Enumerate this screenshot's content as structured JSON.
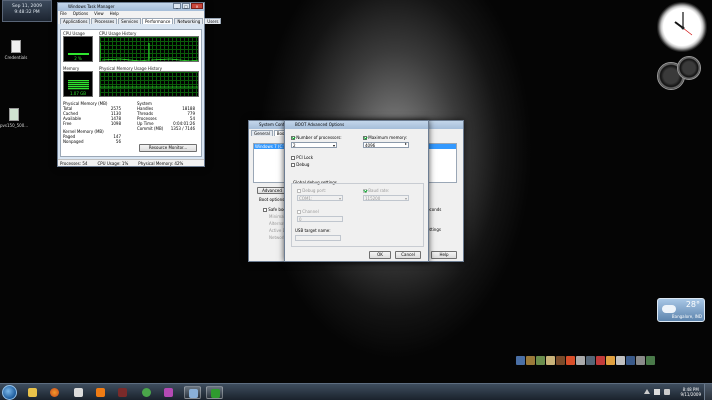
{
  "desktop": {
    "clock_gadget": {
      "date": "Sep 11, 2009",
      "time": "9:48:32 PM"
    },
    "icons": [
      {
        "label": "Credentials"
      },
      {
        "label": "pvs150_500..."
      }
    ],
    "weather": {
      "temp": "28°",
      "location": "Bangalore, IND"
    }
  },
  "task_manager": {
    "title": "Windows Task Manager",
    "menu": [
      "File",
      "Options",
      "View",
      "Help"
    ],
    "tabs": [
      "Applications",
      "Processes",
      "Services",
      "Performance",
      "Networking",
      "Users"
    ],
    "active_tab": "Performance",
    "cpu_usage_label": "CPU Usage",
    "cpu_usage_value": "2 %",
    "cpu_history_label": "CPU Usage History",
    "memory_label": "Memory",
    "memory_value": "1.07 GB",
    "memory_history_label": "Physical Memory Usage History",
    "physical_memory": {
      "header": "Physical Memory (MB)",
      "rows": [
        {
          "k": "Total",
          "v": "2575"
        },
        {
          "k": "Cached",
          "v": "1130"
        },
        {
          "k": "Available",
          "v": "1478"
        },
        {
          "k": "Free",
          "v": "1098"
        }
      ]
    },
    "kernel_memory": {
      "header": "Kernel Memory (MB)",
      "rows": [
        {
          "k": "Paged",
          "v": "147"
        },
        {
          "k": "Nonpaged",
          "v": "56"
        }
      ]
    },
    "system": {
      "header": "System",
      "rows": [
        {
          "k": "Handles",
          "v": "18188"
        },
        {
          "k": "Threads",
          "v": "779"
        },
        {
          "k": "Processes",
          "v": "54"
        },
        {
          "k": "Up Time",
          "v": "0:04:01:26"
        },
        {
          "k": "Commit (MB)",
          "v": "1353 / 7146"
        }
      ]
    },
    "resource_monitor_button": "Resource Monitor...",
    "status": {
      "processes": "Processes: 54",
      "cpu": "CPU Usage: 1%",
      "memory": "Physical Memory: 42%"
    }
  },
  "system_config": {
    "title": "System Configuration",
    "tabs": [
      "General",
      "Boot"
    ],
    "boot_entry": "Windows 7 (C:\\Windows) : Current OS; Default OS",
    "advanced_button": "Advanced options...",
    "boot_options_label": "Boot options",
    "safe_boot_label": "Safe boot",
    "minimal_label": "Minimal",
    "alternate_shell_label": "Alternate shell",
    "active_directory_label": "Active Directory repair",
    "network_label": "Network",
    "seconds_label": "seconds",
    "settings_label": "settings",
    "help_button": "Help"
  },
  "boot_advanced": {
    "title": "BOOT Advanced Options",
    "num_processors_label": "Number of processors:",
    "num_processors_value": "2",
    "max_memory_label": "Maximum memory:",
    "max_memory_value": "4096",
    "pci_lock_label": "PCI Lock",
    "debug_label": "Debug",
    "global_debug_label": "Global debug settings",
    "debug_port_label": "Debug port:",
    "debug_port_value": "COM1:",
    "baud_rate_label": "Baud rate:",
    "baud_rate_value": "115200",
    "channel_label": "Channel",
    "channel_value": "0",
    "usb_target_label": "USB target name:",
    "ok_button": "OK",
    "cancel_button": "Cancel"
  },
  "taskbar": {
    "time": "8:48 PM",
    "date": "9/11/2009"
  },
  "colors": {
    "graph_green": "#2fe62f",
    "graph_bg": "#000000",
    "taskbar": "#2a3644"
  }
}
